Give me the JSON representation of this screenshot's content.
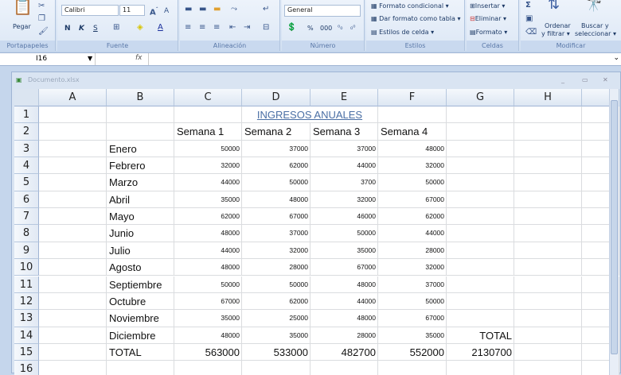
{
  "ribbon": {
    "portapapeles": {
      "label": "Portapapeles",
      "paste": "Pegar"
    },
    "fuente": {
      "label": "Fuente",
      "font": "Calibri",
      "size": "11",
      "bold": "N",
      "italic": "K",
      "underline": "S"
    },
    "alineacion": {
      "label": "Alineación"
    },
    "numero": {
      "label": "Número",
      "format": "General",
      "percent": "%",
      "thousands": "000"
    },
    "estilos": {
      "label": "Estilos",
      "conditional": "Formato condicional ▾",
      "as_table": "Dar formato como tabla ▾",
      "cell_styles": "Estilos de celda ▾"
    },
    "celdas": {
      "label": "Celdas",
      "insert": "Insertar ▾",
      "delete": "Eliminar ▾",
      "format": "Formato ▾"
    },
    "modificar": {
      "label": "Modificar",
      "sort1": "Ordenar",
      "sort2": "y filtrar ▾",
      "find1": "Buscar y",
      "find2": "seleccionar ▾"
    }
  },
  "formula_bar": {
    "name_box": "I16",
    "fx": "fx",
    "value": ""
  },
  "workbook": {
    "title": "Documento.xlsx"
  },
  "sheet": {
    "columns": [
      "A",
      "B",
      "C",
      "D",
      "E",
      "F",
      "G",
      "H"
    ],
    "rows": [
      [
        "",
        "",
        "",
        "INGRESOS ANUALES",
        "",
        "",
        "",
        ""
      ],
      [
        "",
        "",
        "Semana 1",
        "Semana 2",
        "Semana 3",
        "Semana 4",
        "",
        ""
      ],
      [
        "",
        "Enero",
        "50000",
        "37000",
        "37000",
        "48000",
        "",
        ""
      ],
      [
        "",
        "Febrero",
        "32000",
        "62000",
        "44000",
        "32000",
        "",
        ""
      ],
      [
        "",
        "Marzo",
        "44000",
        "50000",
        "3700",
        "50000",
        "",
        ""
      ],
      [
        "",
        "Abril",
        "35000",
        "48000",
        "32000",
        "67000",
        "",
        ""
      ],
      [
        "",
        "Mayo",
        "62000",
        "67000",
        "46000",
        "62000",
        "",
        ""
      ],
      [
        "",
        "Junio",
        "48000",
        "37000",
        "50000",
        "44000",
        "",
        ""
      ],
      [
        "",
        "Julio",
        "44000",
        "32000",
        "35000",
        "28000",
        "",
        ""
      ],
      [
        "",
        "Agosto",
        "48000",
        "28000",
        "67000",
        "32000",
        "",
        ""
      ],
      [
        "",
        "Septiembre",
        "50000",
        "50000",
        "48000",
        "37000",
        "",
        ""
      ],
      [
        "",
        "Octubre",
        "67000",
        "62000",
        "44000",
        "50000",
        "",
        ""
      ],
      [
        "",
        "Noviembre",
        "35000",
        "25000",
        "48000",
        "67000",
        "",
        ""
      ],
      [
        "",
        "Diciembre",
        "48000",
        "35000",
        "28000",
        "35000",
        "TOTAL",
        ""
      ],
      [
        "",
        "TOTAL",
        "563000",
        "533000",
        "482700",
        "552000",
        "2130700",
        ""
      ],
      [
        "",
        "",
        "",
        "",
        "",
        "",
        "",
        ""
      ]
    ]
  }
}
